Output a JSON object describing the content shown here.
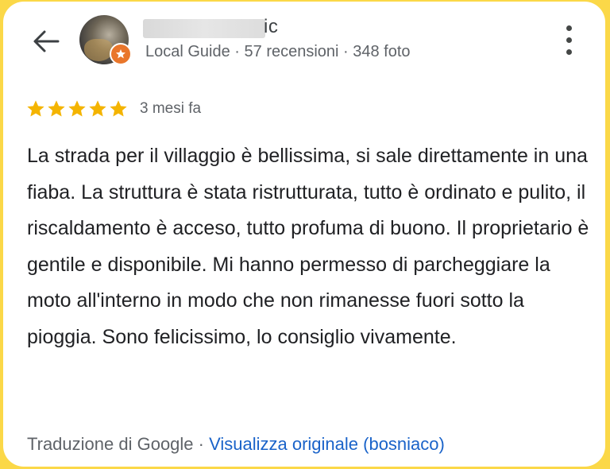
{
  "header": {
    "name_visible": "ic",
    "meta": "Local Guide · 57 recensioni · 348 foto"
  },
  "review": {
    "rating": 5,
    "date": "3 mesi fa",
    "text": "La strada per il villaggio è bellissima, si sale direttamente in una fiaba. La struttura è stata ristrutturata, tutto è ordinato e pulito, il riscaldamento è acceso, tutto profuma di buono. Il proprietario è gentile e disponibile. Mi hanno permesso di parcheggiare la moto all'interno in modo che non rimanesse fuori sotto la pioggia. Sono felicissimo, lo consiglio vivamente."
  },
  "footer": {
    "translated_by": "Traduzione di Google · ",
    "view_original": "Visualizza originale (bosniaco)"
  },
  "colors": {
    "star": "#f4b400",
    "link": "#1a63c9",
    "badge": "#e9762b",
    "frame": "#fbd848"
  },
  "icons": [
    "back-arrow-icon",
    "local-guide-badge-icon",
    "more-vert-icon",
    "star-icon"
  ]
}
